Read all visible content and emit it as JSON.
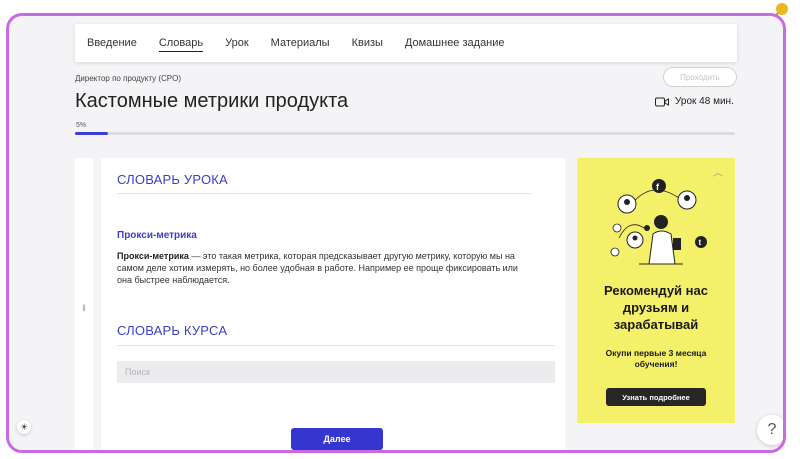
{
  "nav": {
    "items": [
      {
        "label": "Введение"
      },
      {
        "label": "Словарь",
        "active": true
      },
      {
        "label": "Урок"
      },
      {
        "label": "Материалы"
      },
      {
        "label": "Квизы"
      },
      {
        "label": "Домашнее задание"
      }
    ]
  },
  "header": {
    "breadcrumb": "Директор по продукту (CPO)",
    "title": "Кастомные метрики продукта",
    "action_label": "Проходить",
    "lesson_duration": "Урок 48 мин.",
    "progress_text": "5%",
    "progress_value": 0.05
  },
  "lesson_glossary": {
    "title": "СЛОВАРЬ УРОКА",
    "term": "Прокси-метрика",
    "def_term": "Прокси-метрика",
    "definition": "— это такая метрика, которая предсказывает другую метрику, которую мы на самом деле хотим измерять, но более удобная в работе. Например ее проще фиксировать или она быстрее наблюдается."
  },
  "course_glossary": {
    "title": "СЛОВАРЬ КУРСА",
    "search_placeholder": "Поиск"
  },
  "next_button": "Далее",
  "promo": {
    "title": "Рекомендуй нас\nдрузьям и\nзарабатывай",
    "subtitle": "Окупи первые 3 месяца\nобучения!",
    "button": "Узнать подробнее"
  },
  "help_label": "?",
  "colors": {
    "accent": "#3535cf",
    "promo_bg": "#f5f06a",
    "frame": "#c86be0"
  }
}
